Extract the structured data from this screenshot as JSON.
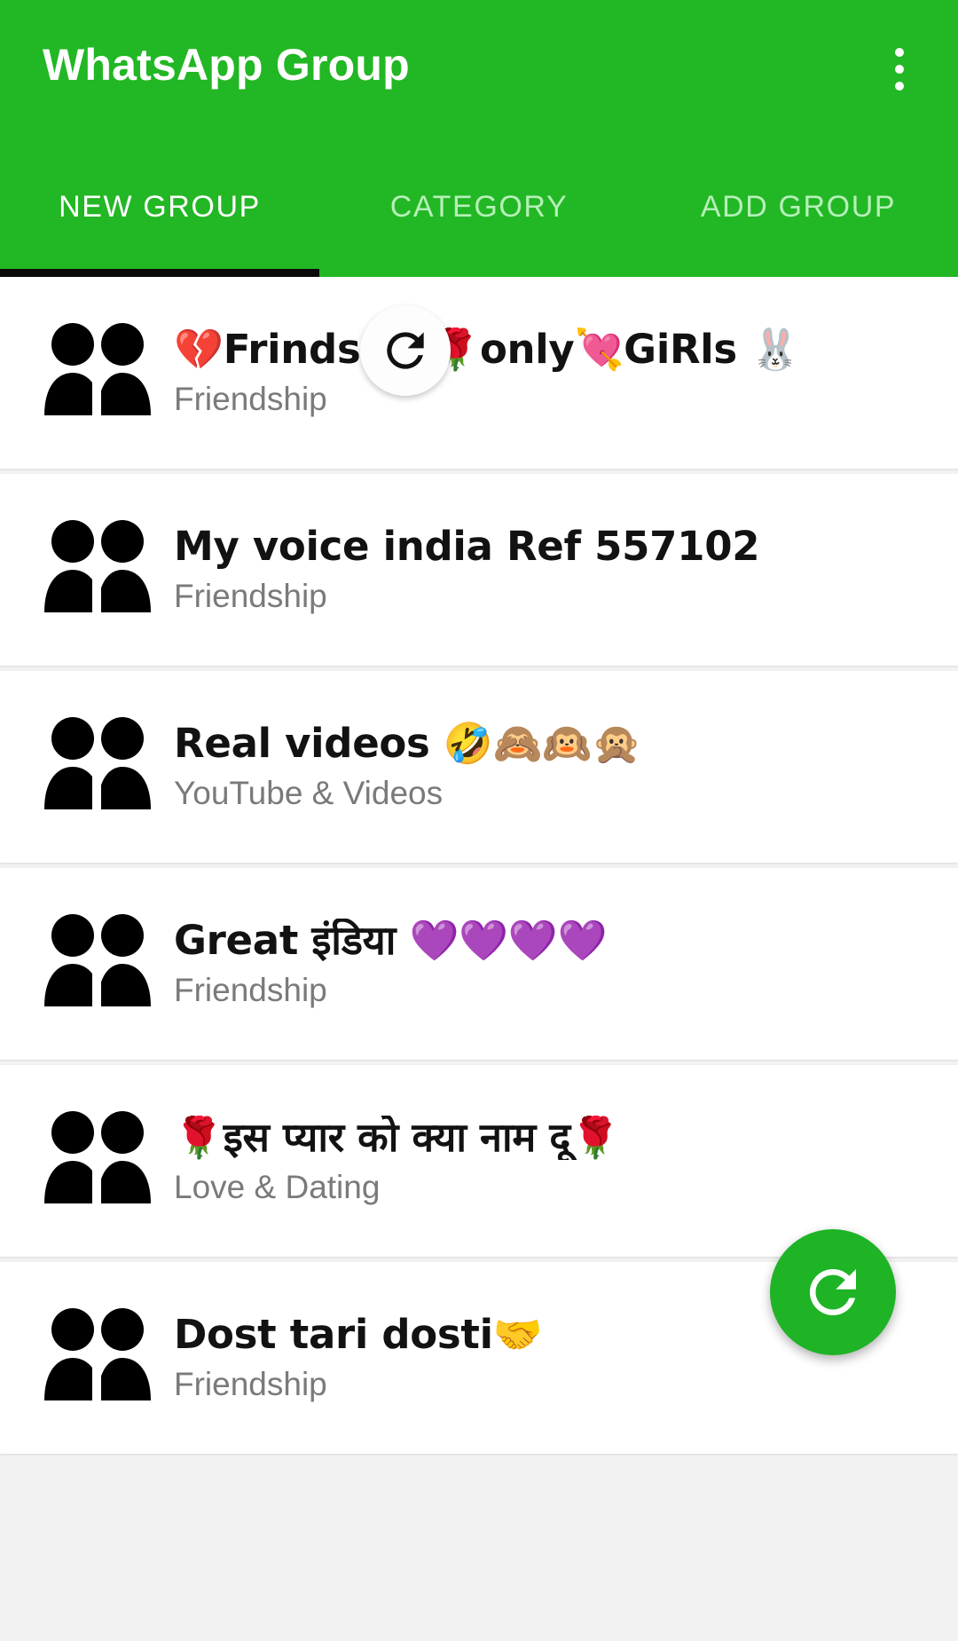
{
  "app": {
    "title": "WhatsApp Group",
    "accent_color": "#22b724",
    "tab_active_color": "#ffffff",
    "tab_inactive_color": "#b6f0b8",
    "indicator_color": "#0a0a0a",
    "fab_color": "#1fb326"
  },
  "header": {
    "overflow_icon": "more-vertical-icon"
  },
  "tabs": [
    {
      "label": "NEW GROUP",
      "active": true
    },
    {
      "label": "CATEGORY",
      "active": false
    },
    {
      "label": "ADD GROUP",
      "active": false
    }
  ],
  "refresh": {
    "spinner_icon": "refresh-icon",
    "fab_icon": "refresh-icon"
  },
  "list": {
    "row_icon": "group-people-icon",
    "items": [
      {
        "title": "💔Frindship🌹only💘GiRls 🐰",
        "category": "Friendship"
      },
      {
        "title": "My voice india Ref 557102",
        "category": "Friendship"
      },
      {
        "title": "Real videos 🤣🙈🙉🙊",
        "category": "YouTube & Videos"
      },
      {
        "title": "Great इंडिया 💜💜💜💜",
        "category": "Friendship"
      },
      {
        "title": "🌹इस प्यार को क्या नाम दू🌹",
        "category": "Love & Dating"
      },
      {
        "title": "Dost tari dosti🤝",
        "category": "Friendship"
      }
    ]
  }
}
